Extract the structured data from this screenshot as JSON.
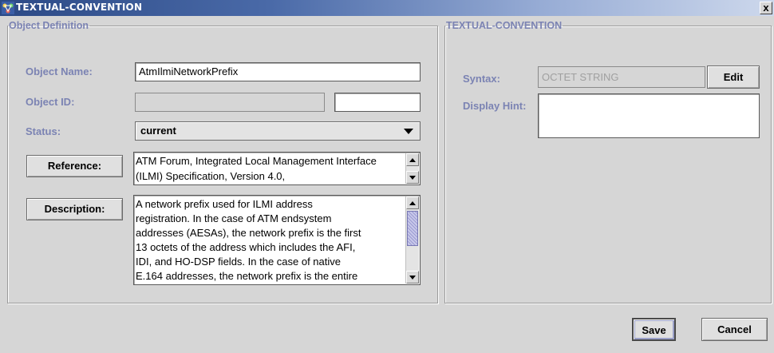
{
  "window": {
    "title": "TEXTUAL-CONVENTION",
    "app_icon": "network-app-icon",
    "close_glyph": "x"
  },
  "object_definition": {
    "legend": "Object Definition",
    "object_name_label": "Object Name:",
    "object_name_value": "AtmIlmiNetworkPrefix",
    "object_id_label": "Object ID:",
    "object_id_value": "",
    "object_id_suffix": "",
    "status_label": "Status:",
    "status_value": "current",
    "reference_button": "Reference:",
    "reference_text": "ATM Forum, Integrated Local Management Interface\n (ILMI) Specification, Version 4.0,",
    "description_button": "Description:",
    "description_text": "A network prefix used for ILMI address\nregistration.  In the case of ATM endsystem\naddresses (AESAs), the network prefix is the first\n13 octets of the address which includes the AFI,\nIDI, and HO-DSP fields.  In the case of native\nE.164 addresses, the network prefix is the entire"
  },
  "textual_convention": {
    "legend": "TEXTUAL-CONVENTION",
    "syntax_label": "Syntax:",
    "syntax_value": "OCTET STRING",
    "edit_button": "Edit",
    "display_hint_label": "Display Hint:",
    "display_hint_value": ""
  },
  "footer": {
    "save_button": "Save",
    "cancel_button": "Cancel"
  }
}
